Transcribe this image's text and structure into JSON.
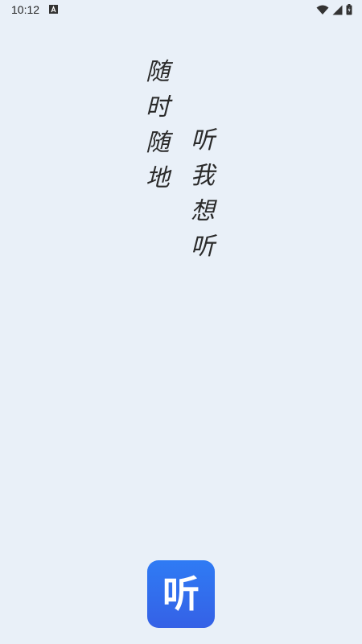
{
  "status_bar": {
    "time": "10:12",
    "notification_icon": "a-icon",
    "right_icons": [
      "wifi-icon",
      "signal-icon",
      "battery-icon"
    ]
  },
  "slogan": {
    "left_column": [
      "随",
      "时",
      "随",
      "地"
    ],
    "right_column": [
      "听",
      "我",
      "想",
      "听"
    ]
  },
  "app_logo": {
    "text": "听",
    "color": "#3561e6"
  },
  "colors": {
    "background": "#e9f0f8",
    "text": "#2a2a2a",
    "accent": "#2f7bf4"
  }
}
